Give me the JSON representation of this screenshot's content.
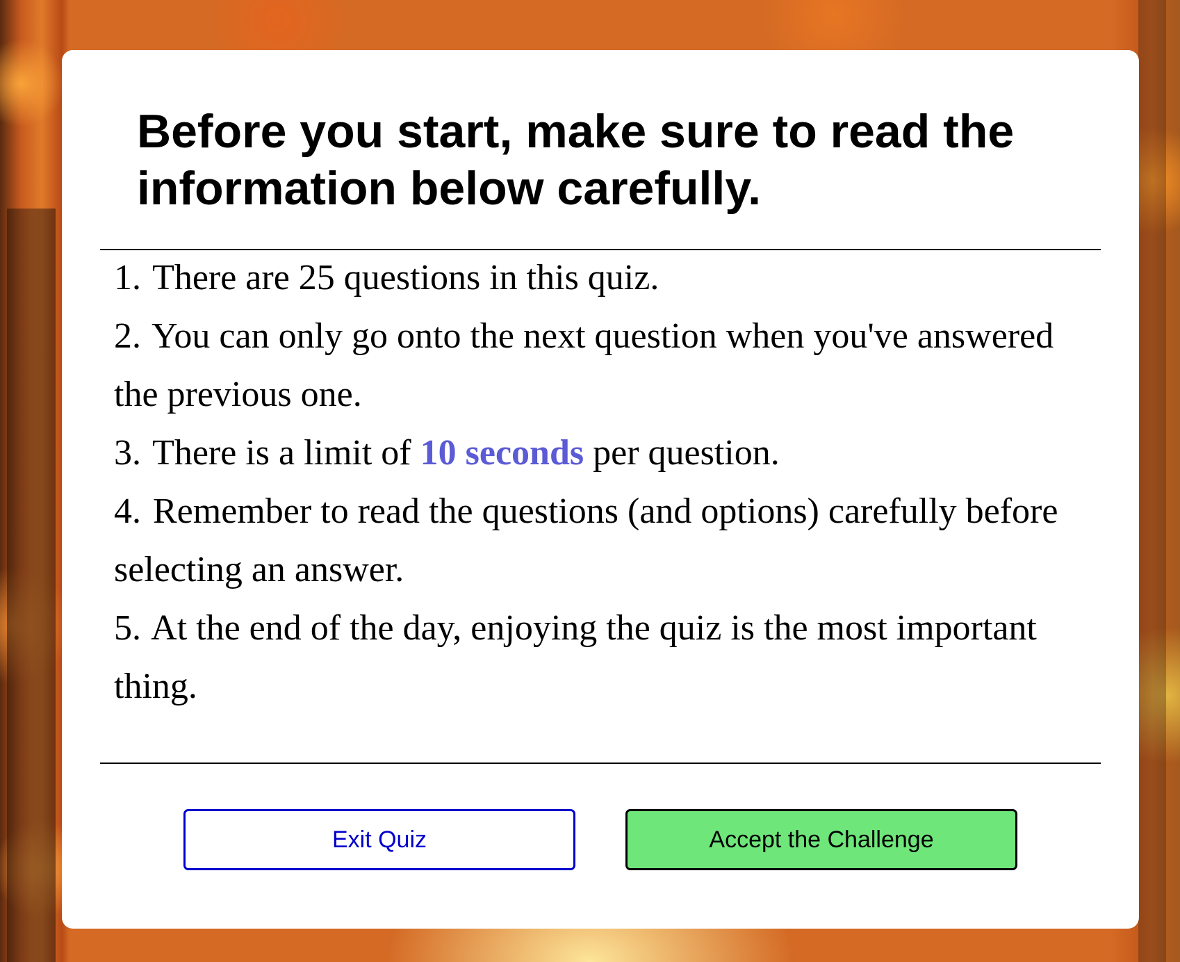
{
  "modal": {
    "title": "Before you start, make sure to read the information below carefully.",
    "rules": [
      {
        "num": "1.",
        "text": "There are 25 questions in this quiz."
      },
      {
        "num": "2.",
        "text": "You can only go onto the next question when you've answered the previous one."
      },
      {
        "num": "3.",
        "before": "There is a limit of",
        "highlight": "10 seconds",
        "after": "per question."
      },
      {
        "num": "4.",
        "text": "Remember to read the questions (and options) carefully before selecting an answer."
      },
      {
        "num": "5.",
        "text": "At the end of the day, enjoying the quiz is the most important thing."
      }
    ],
    "buttons": {
      "exit_label": "Exit Quiz",
      "accept_label": "Accept the Challenge"
    }
  },
  "colors": {
    "highlight": "#5b5bd6",
    "accept_bg": "#6fe67a",
    "exit_border": "#0000cc"
  }
}
